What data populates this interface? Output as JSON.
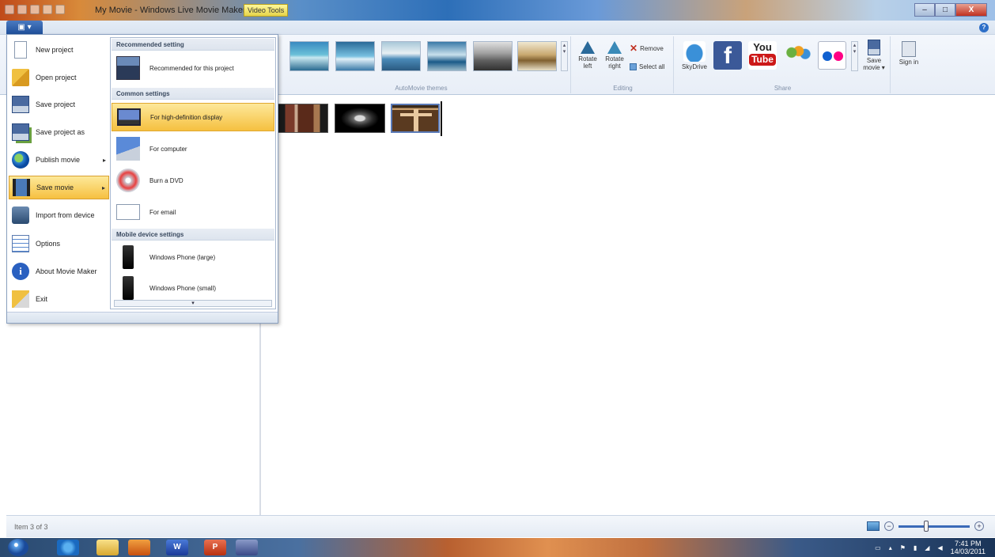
{
  "window": {
    "title": "My Movie - Windows Live Movie Maker",
    "context_tab": "Video Tools",
    "min_label": "–",
    "max_label": "□",
    "close_label": "X"
  },
  "ribbon": {
    "app_button_label": "▣ ▾",
    "help_label": "?",
    "groups": {
      "themes_label": "AutoMovie themes",
      "editing_label": "Editing",
      "share_label": "Share"
    },
    "editing": {
      "rotate_left": "Rotate left",
      "rotate_right": "Rotate right",
      "remove": "Remove",
      "select_all": "Select all"
    },
    "share": {
      "skydrive": "SkyDrive",
      "facebook": "f",
      "youtube_top": "You",
      "youtube_bottom": "Tube",
      "save_movie": "Save movie ▾",
      "sign_in": "Sign in"
    }
  },
  "app_menu": {
    "items": [
      {
        "label": "New project",
        "icon": "new-document-icon"
      },
      {
        "label": "Open project",
        "icon": "open-folder-icon"
      },
      {
        "label": "Save project",
        "icon": "save-icon"
      },
      {
        "label": "Save project as",
        "icon": "save-as-icon"
      },
      {
        "label": "Publish movie",
        "icon": "globe-icon",
        "arrow": "▸"
      },
      {
        "label": "Save movie",
        "icon": "film-icon",
        "arrow": "▸"
      },
      {
        "label": "Import from device",
        "icon": "camera-icon"
      },
      {
        "label": "Options",
        "icon": "options-icon"
      },
      {
        "label": "About Movie Maker",
        "icon": "info-icon",
        "glyph": "i"
      },
      {
        "label": "Exit",
        "icon": "exit-icon"
      }
    ]
  },
  "submenu": {
    "recommended_header": "Recommended setting",
    "recommended_item": "Recommended for this project",
    "common_header": "Common settings",
    "common_items": [
      "For high-definition display",
      "For computer",
      "Burn a DVD",
      "For email"
    ],
    "mobile_header": "Mobile device settings",
    "mobile_items": [
      "Windows Phone (large)",
      "Windows Phone (small)"
    ],
    "scroll_glyph": "▾"
  },
  "status": {
    "item_count": "Item 3 of 3",
    "zoom_out": "−",
    "zoom_in": "+"
  },
  "taskbar": {
    "time": "7:41 PM",
    "date": "14/03/2011",
    "word": "W",
    "ppt": "P"
  }
}
